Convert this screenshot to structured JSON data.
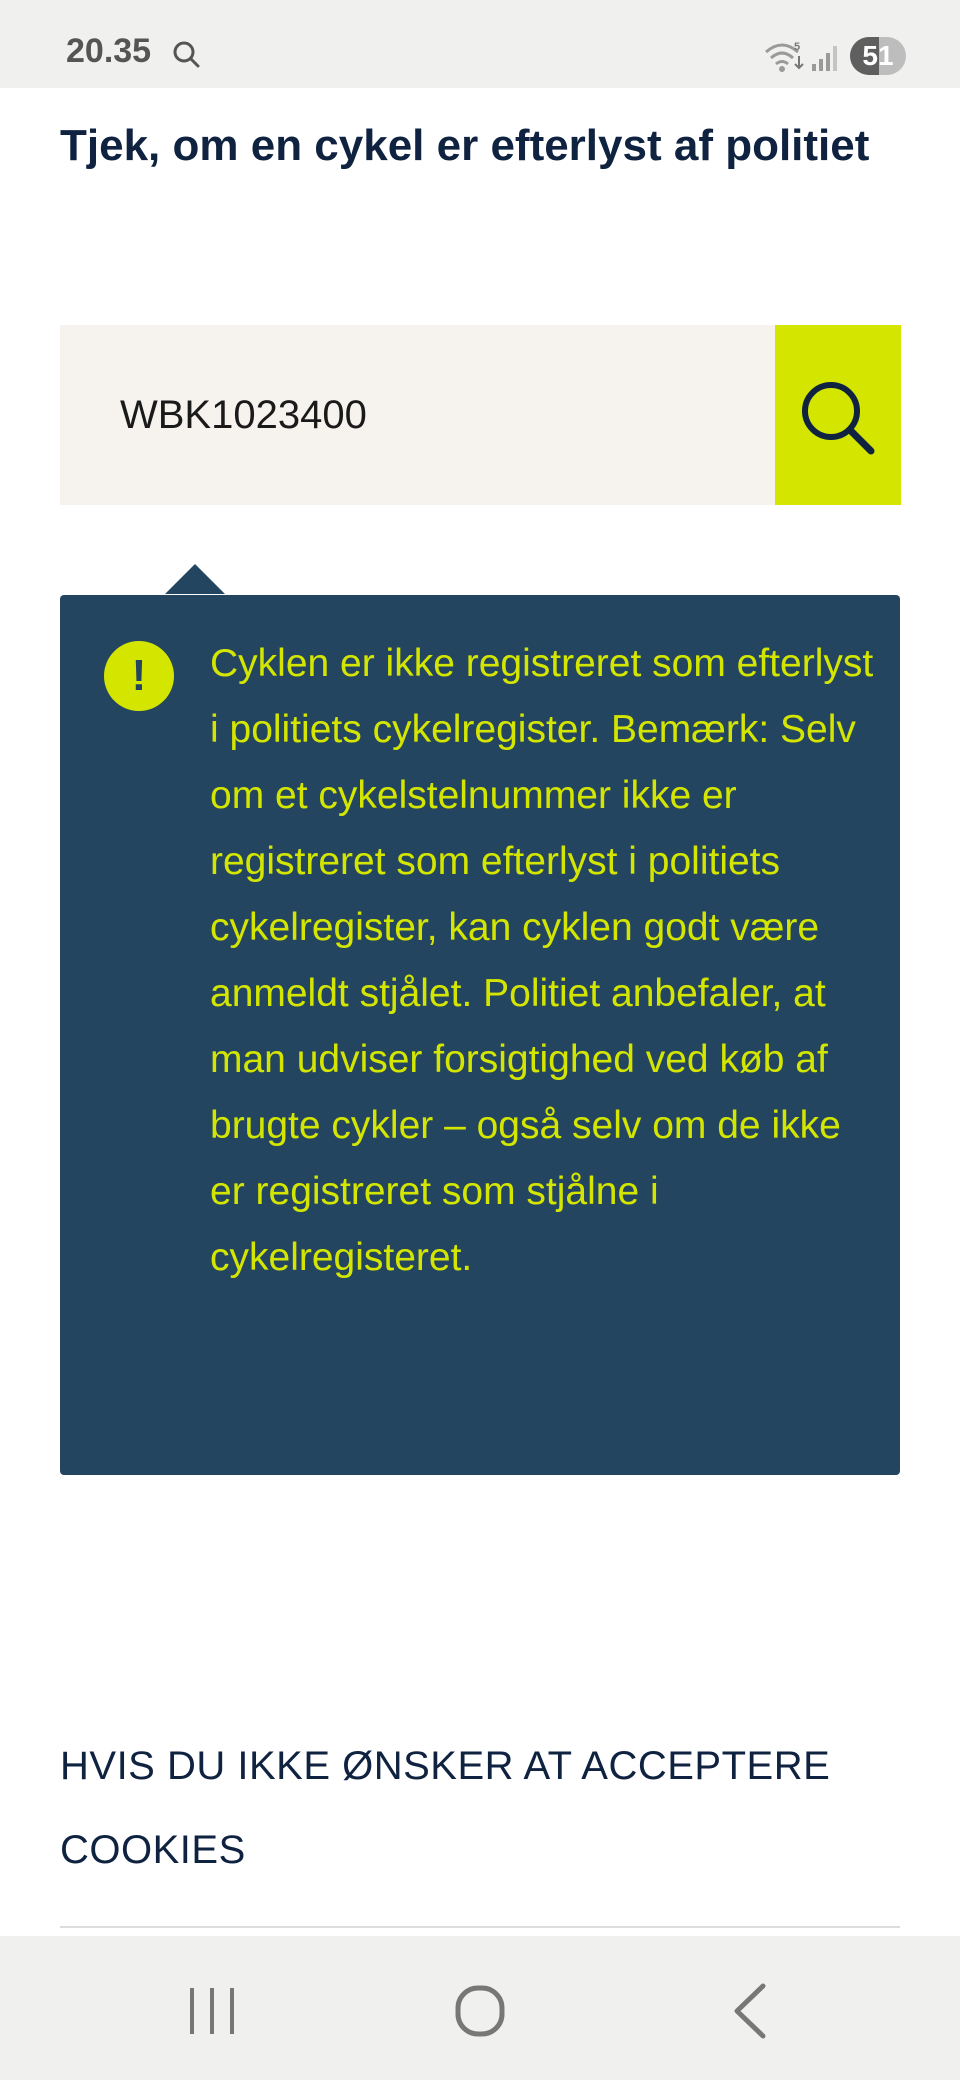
{
  "status_bar": {
    "time": "20.35",
    "battery": "51",
    "battery_level": 0.51,
    "wifi_badge": "5",
    "icons": [
      "search-icon",
      "wifi-icon",
      "signal-icon",
      "battery-icon"
    ]
  },
  "page": {
    "heading": "Tjek, om en cykel er efterlyst af politiet"
  },
  "search": {
    "value": "WBK1023400",
    "button_icon": "search-icon"
  },
  "notice": {
    "icon": "exclamation-icon",
    "icon_symbol": "!",
    "text": "Cyklen er ikke registreret som efterlyst i politiets cykelregister. Bemærk: Selv om et cykelstelnummer ikke er registreret som efterlyst i politiets cykelregister, kan cyklen godt være anmeldt stjålet. Politiet anbefaler, at man udviser forsigtighed ved køb af brugte cykler – også selv om de ikke er registreret som stjålne i cykelregisteret."
  },
  "cookies": {
    "link_text": "HVIS DU IKKE ØNSKER AT ACCEPTERE COOKIES"
  },
  "nav_bar": {
    "icons": [
      "recent-apps-icon",
      "home-icon",
      "back-icon"
    ]
  },
  "colors": {
    "accent": "#d4e600",
    "notice_background": "#234560",
    "heading_text": "#0f2240",
    "search_background": "#f6f3ef"
  }
}
